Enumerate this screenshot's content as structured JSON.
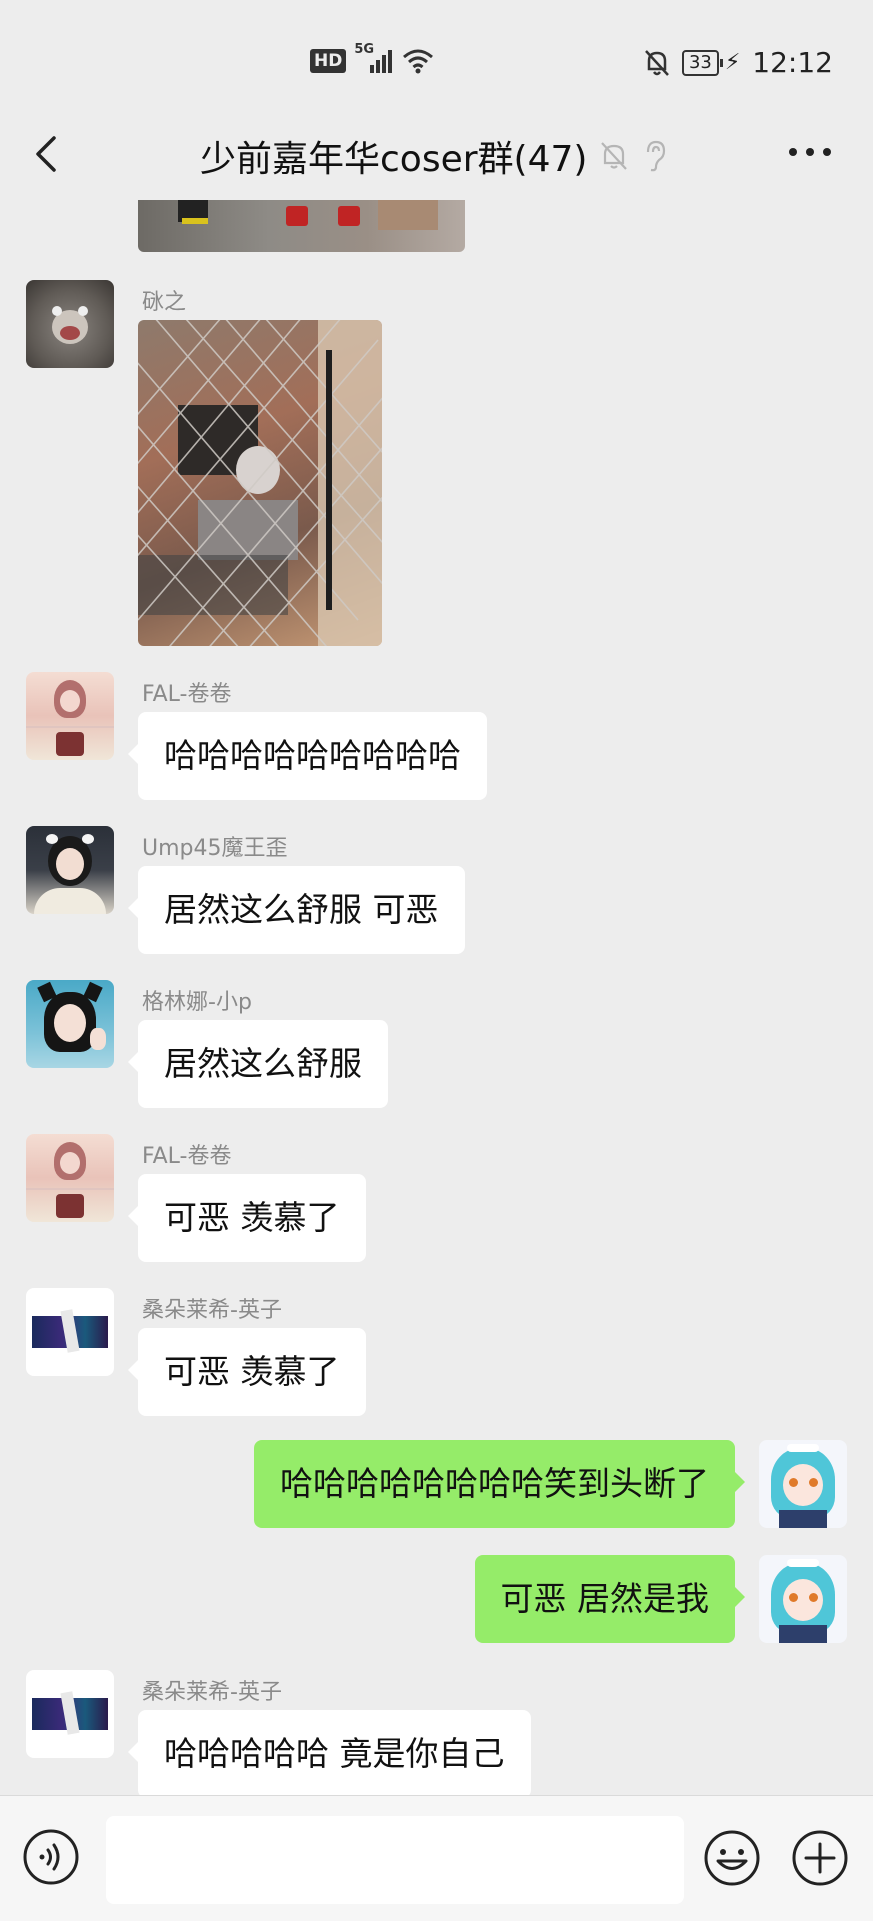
{
  "status_bar": {
    "hd_label": "HD",
    "network_label": "5G",
    "battery": "33",
    "time": "12:12"
  },
  "header": {
    "title": "少前嘉年华coser群(47)"
  },
  "messages": [
    {
      "id": "m1",
      "side": "left",
      "sender": "砯之",
      "type": "image"
    },
    {
      "id": "m2",
      "side": "left",
      "sender": "FAL-卷卷",
      "text": "哈哈哈哈哈哈哈哈哈"
    },
    {
      "id": "m3",
      "side": "left",
      "sender": "Ump45魔王歪",
      "text": "居然这么舒服 可恶"
    },
    {
      "id": "m4",
      "side": "left",
      "sender": "格林娜-小p",
      "text": "居然这么舒服"
    },
    {
      "id": "m5",
      "side": "left",
      "sender": "FAL-卷卷",
      "text": "可恶 羡慕了"
    },
    {
      "id": "m6",
      "side": "left",
      "sender": "桑朵莱希-英子",
      "text": "可恶 羡慕了"
    },
    {
      "id": "m7",
      "side": "right",
      "text": "哈哈哈哈哈哈哈哈笑到头断了"
    },
    {
      "id": "m8",
      "side": "right",
      "text": "可恶 居然是我"
    },
    {
      "id": "m9",
      "side": "left",
      "sender": "桑朵莱希-英子",
      "text": "哈哈哈哈哈 竟是你自己"
    }
  ],
  "icons": {
    "back": "chevron-left-icon",
    "mute": "bell-off-icon",
    "earpiece": "ear-icon",
    "more": "more-dots-icon",
    "voice": "voice-icon",
    "emoji": "emoji-icon",
    "plus": "plus-icon"
  },
  "colors": {
    "background": "#ededed",
    "bubble_self": "#95ec69",
    "bubble_other": "#ffffff"
  }
}
